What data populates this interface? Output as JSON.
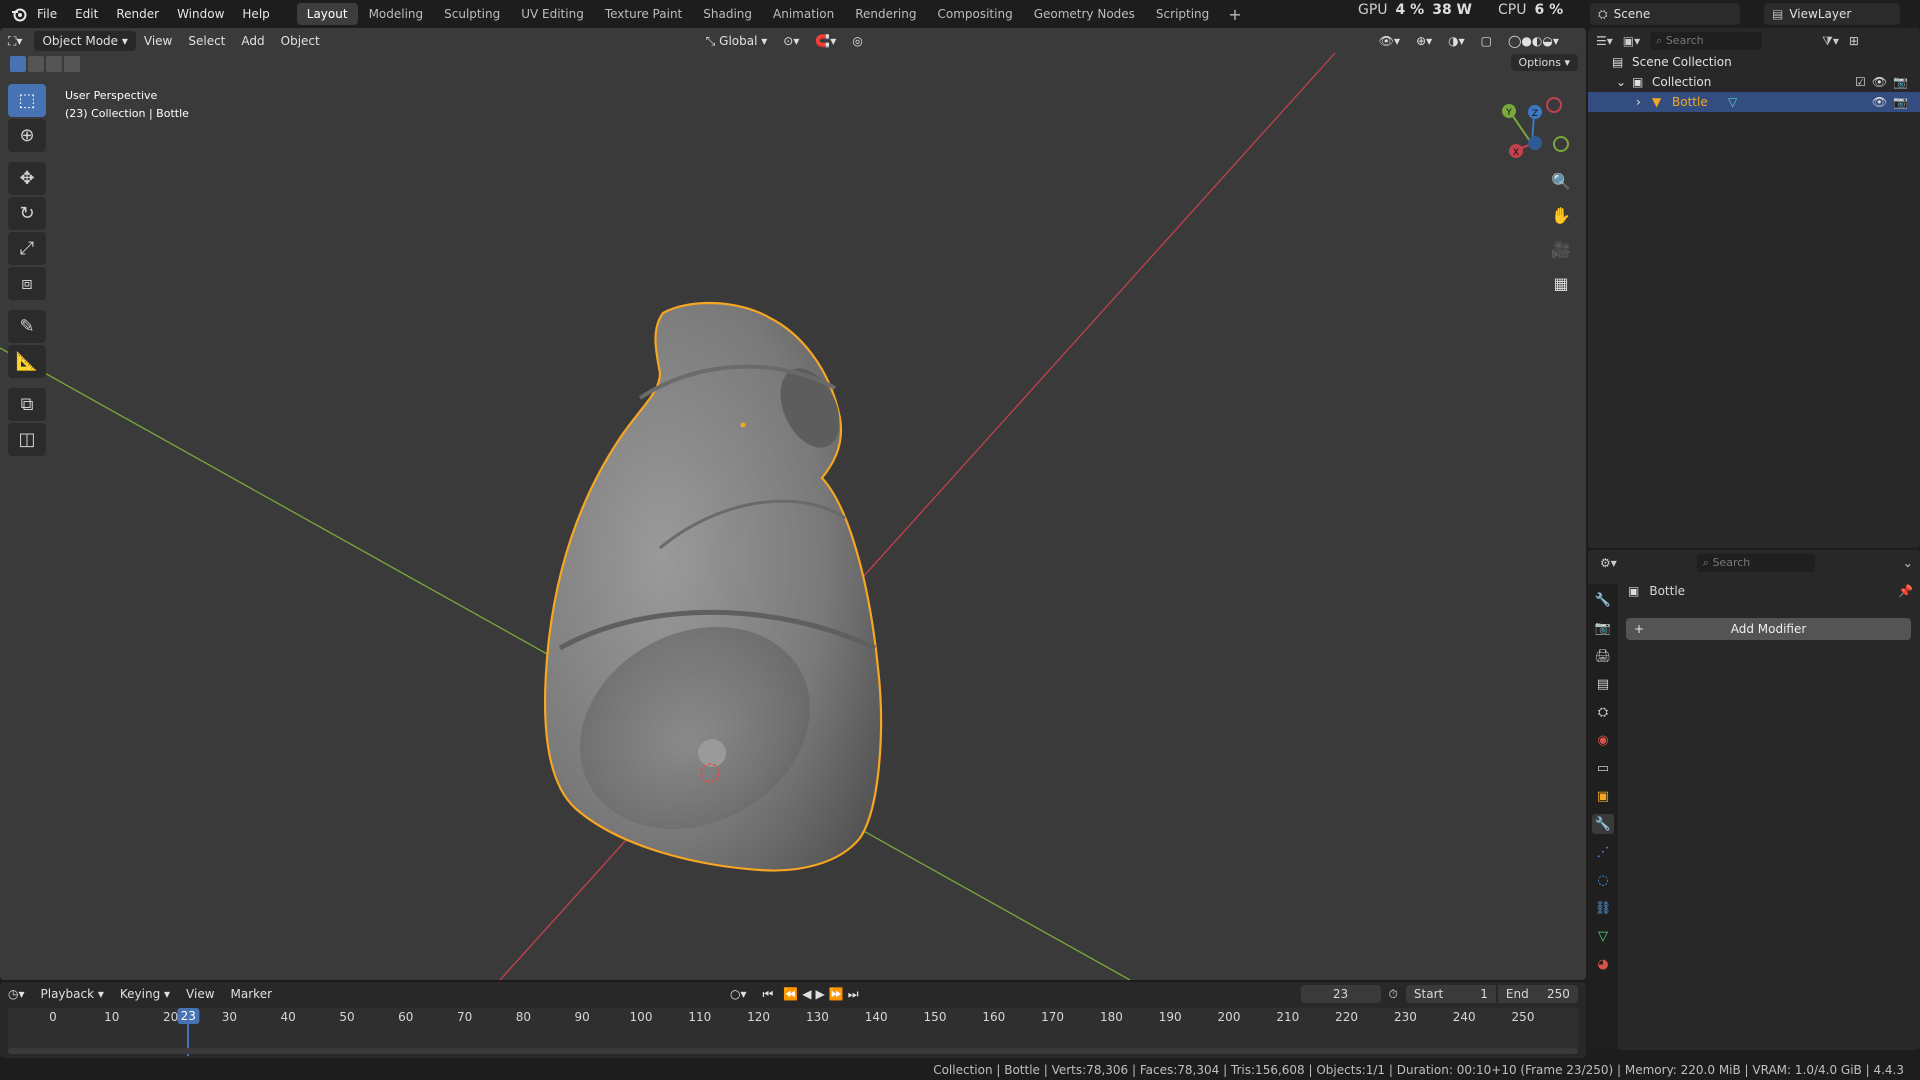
{
  "menu": {
    "file": "File",
    "edit": "Edit",
    "render": "Render",
    "window": "Window",
    "help": "Help"
  },
  "workspaces": [
    "Layout",
    "Modeling",
    "Sculpting",
    "UV Editing",
    "Texture Paint",
    "Shading",
    "Animation",
    "Rendering",
    "Compositing",
    "Geometry Nodes",
    "Scripting"
  ],
  "active_workspace": "Layout",
  "perf": {
    "gpu_label": "GPU",
    "gpu_value": "4 %",
    "power": "38 W",
    "cpu_label": "CPU",
    "cpu_value": "6 %"
  },
  "scene": {
    "name": "Scene",
    "view_layer": "ViewLayer"
  },
  "viewport": {
    "mode": "Object Mode",
    "menus": {
      "view": "View",
      "select": "Select",
      "add": "Add",
      "object": "Object"
    },
    "transform_orientation": "Global",
    "options": "Options",
    "info_line1": "User Perspective",
    "info_line2": "(23) Collection | Bottle",
    "gizmo_axes": {
      "x": "X",
      "y": "Y",
      "z": "Z"
    },
    "colors": {
      "x_axis": "#c3414e",
      "y_axis": "#79a83c",
      "z_axis": "#3c78c3",
      "selection": "#f5a623",
      "background": "#3a3a3a"
    }
  },
  "outliner": {
    "search_placeholder": "Search",
    "scene_collection": "Scene Collection",
    "collection": "Collection",
    "object": "Bottle"
  },
  "properties": {
    "search_placeholder": "Search",
    "object_name": "Bottle",
    "add_modifier": "Add Modifier"
  },
  "timeline": {
    "menus": {
      "playback": "Playback",
      "keying": "Keying",
      "view": "View",
      "marker": "Marker"
    },
    "current_frame": "23",
    "start_label": "Start",
    "start_value": "1",
    "end_label": "End",
    "end_value": "250",
    "ticks": [
      "0",
      "10",
      "20",
      "30",
      "40",
      "50",
      "60",
      "70",
      "80",
      "90",
      "100",
      "110",
      "120",
      "130",
      "140",
      "150",
      "160",
      "170",
      "180",
      "190",
      "200",
      "210",
      "220",
      "230",
      "240",
      "250"
    ]
  },
  "status": "Collection | Bottle | Verts:78,306 | Faces:78,304 | Tris:156,608 | Objects:1/1 | Duration: 00:10+10 (Frame 23/250) | Memory: 220.0 MiB | VRAM: 1.0/4.0 GiB | 4.4.3"
}
